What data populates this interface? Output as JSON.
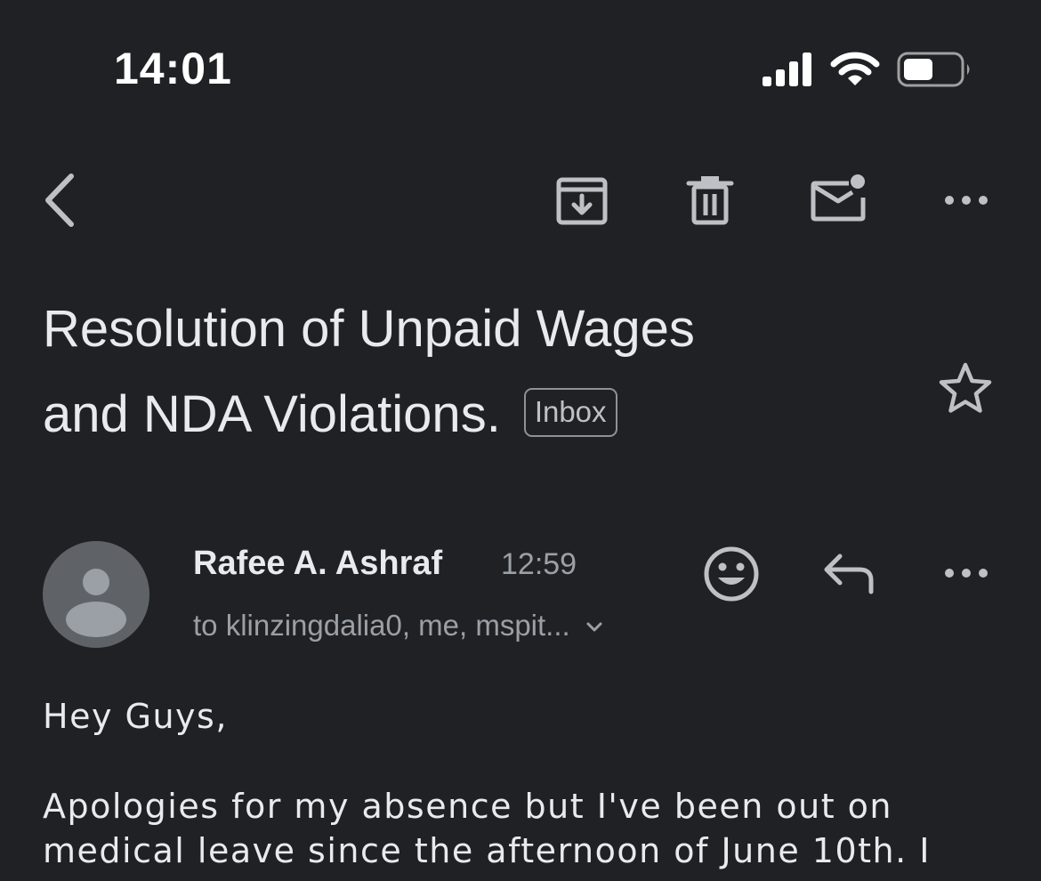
{
  "status_bar": {
    "time": "14:01",
    "icons": [
      "signal-icon",
      "wifi-icon",
      "battery-icon"
    ]
  },
  "toolbar": {
    "icons": [
      "back-icon",
      "archive-icon",
      "trash-icon",
      "mark-unread-icon",
      "more-icon"
    ]
  },
  "email": {
    "subject_line1": "Resolution of Unpaid Wages",
    "subject_line2": "and NDA Violations.",
    "label": "Inbox",
    "sender": {
      "name": "Rafee A. Ashraf",
      "time": "12:59",
      "recipients": "to klinzingdalia0, me, mspit..."
    },
    "body": {
      "greeting": "Hey Guys,",
      "line1": "Apologies for my absence but I've been out on",
      "line2": "medical leave since the afternoon of June 10th. I"
    }
  },
  "colors": {
    "background": "#202124",
    "text": "#e8eaed",
    "secondary": "#9aa0a6",
    "avatar": "#5f6368"
  }
}
